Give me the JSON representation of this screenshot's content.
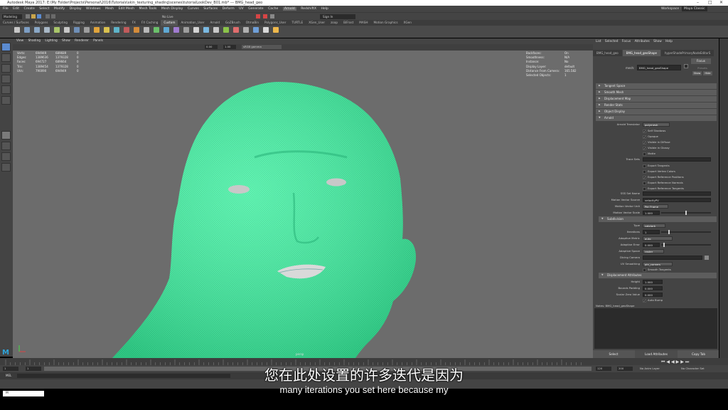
{
  "title": "Autodesk Maya 2017: E:\\My Folder\\Projects\\Personal\\2016\\Tutorials\\skin_texturing_shading\\scenes\\tutorialLookDev_B01.mb* --- BMG_head_geo",
  "menu": [
    "File",
    "Edit",
    "Create",
    "Select",
    "Modify",
    "Display",
    "Windows",
    "Mesh",
    "Edit Mesh",
    "Mesh Tools",
    "Mesh Display",
    "Curves",
    "Surfaces",
    "Deform",
    "UV",
    "Generate",
    "Cache",
    "Arnold",
    "RedshiftX",
    "Help"
  ],
  "workspace": {
    "label": "Workspace :",
    "value": "Maya Classic"
  },
  "status": {
    "mode": "Modeling",
    "live_surface": "No Live Surface",
    "sign_in": "Sign In"
  },
  "shelf_tabs": [
    "Curves / Surfaces",
    "Polygons",
    "Sculpting",
    "Rigging",
    "Animation",
    "Rendering",
    "FX",
    "FX Caching",
    "Custom",
    "Animation_User",
    "Arnold",
    "GoZBrush",
    "OtmaBin",
    "Polygons_User",
    "TURTLE",
    "XGen_User",
    "zoap",
    "BiFrost",
    "MASH",
    "Motion Graphics",
    "XGen"
  ],
  "active_shelf_tab": "Custom",
  "viewport_menu": [
    "View",
    "Shading",
    "Lighting",
    "Show",
    "Renderer",
    "Panels"
  ],
  "viewport_toolbar": {
    "val1": "0.00",
    "val2": "1.00",
    "colorspace": "sRGB gamma"
  },
  "hud_left": {
    "rows": [
      {
        "label": "Verts:",
        "a": "694949",
        "b": "689689",
        "c": "0"
      },
      {
        "label": "Edges:",
        "a": "1389636",
        "b": "1379328",
        "c": "0"
      },
      {
        "label": "Faces:",
        "a": "694727",
        "b": "689664",
        "c": "0"
      },
      {
        "label": "Tris:",
        "a": "1389454",
        "b": "1379328",
        "c": "0"
      },
      {
        "label": "UVs:",
        "a": "790090",
        "b": "694949",
        "c": "0"
      }
    ]
  },
  "hud_right": {
    "rows": [
      {
        "label": "Backfaces:",
        "value": "On"
      },
      {
        "label": "Smoothness:",
        "value": "N/A"
      },
      {
        "label": "Instance:",
        "value": "No"
      },
      {
        "label": "Display Layer:",
        "value": "default"
      },
      {
        "label": "Distance From Camera:",
        "value": "165.582"
      },
      {
        "label": "Selected Objects:",
        "value": "1"
      }
    ]
  },
  "viewport_label": "persp",
  "right_panel": {
    "menu": [
      "List",
      "Selected",
      "Focus",
      "Attributes",
      "Show",
      "Help"
    ],
    "tabs": [
      "BMG_head_geo",
      "BMG_head_geoShape",
      "hyperShadePrimaryNodeEditorS"
    ],
    "active_tab": "BMG_head_geoShape",
    "mesh_label": "mesh:",
    "mesh_value": "BMG_head_geoShape",
    "focus_btn": "Focus",
    "presets_btn": "Presets",
    "show_btn": "Show",
    "hide_btn": "Hide",
    "sections": [
      "Tangent Space",
      "Smooth Mesh",
      "Displacement Map",
      "Render Stats",
      "Object Display",
      "Arnold"
    ],
    "arnold_translator_label": "Arnold Translator",
    "arnold_translator_value": "polymesh",
    "arnold_checks": [
      {
        "label": "Self Shadows",
        "checked": true
      },
      {
        "label": "Opaque",
        "checked": true
      },
      {
        "label": "Visible in Diffuse",
        "checked": true
      },
      {
        "label": "Visible in Glossy",
        "checked": true
      },
      {
        "label": "Matte",
        "checked": false
      }
    ],
    "trace_sets_label": "Trace Sets",
    "export_checks": [
      {
        "label": "Export Tangents",
        "checked": false
      },
      {
        "label": "Export Vertex Colors",
        "checked": false
      },
      {
        "label": "Export Reference Positions",
        "checked": true
      },
      {
        "label": "Export Reference Normals",
        "checked": false
      },
      {
        "label": "Export Reference Tangents",
        "checked": false
      }
    ],
    "sss_label": "SSS Set Name",
    "motion_source_label": "Motion Vector Source",
    "motion_source_value": "velocityPV",
    "motion_unit_label": "Motion Vector Unit",
    "motion_unit_value": "Per Frame",
    "motion_scale_label": "Motion Vector Scale",
    "motion_scale_value": "1.000",
    "subdiv_section": "Subdivision",
    "type_label": "Type",
    "type_value": "catclark",
    "iterations_label": "Iterations",
    "iterations_value": "1",
    "adaptive_metric_label": "Adaptive Metric",
    "adaptive_metric_value": "auto",
    "adaptive_error_label": "Adaptive Error",
    "adaptive_error_value": "0.000",
    "adaptive_space_label": "Adaptive Space",
    "adaptive_space_value": "raster",
    "dicing_label": "Dicing Camera",
    "uv_smoothing_label": "UV Smoothing",
    "uv_smoothing_value": "pin_corners",
    "smooth_tangents_label": "Smooth Tangents",
    "disp_section": "Displacement Attributes",
    "height_label": "Height",
    "height_value": "1.000",
    "bounds_label": "Bounds Padding",
    "bounds_value": "0.000",
    "scalar_label": "Scalar Zero Value",
    "scalar_value": "0.000",
    "autobump_label": "Auto Bump",
    "notes_label": "Notes: BMG_head_geoShape",
    "bottom_buttons": [
      "Select",
      "Load Attributes",
      "Copy Tab"
    ]
  },
  "timeline": {
    "start": "1",
    "start2": "1",
    "end": "120",
    "end2": "200",
    "anim_layer": "No Anim Layer",
    "char_set": "No Character Set"
  },
  "cmd_label": "MEL",
  "taskbar_item": "M",
  "subtitle_cn": "您在此处设置的许多迭代是因为",
  "subtitle_en": "many iterations you set here because my",
  "colors": {
    "mesh": "#3ff5a3",
    "viewport_bg": "#6c6c6c",
    "ui_bg": "#444444"
  }
}
